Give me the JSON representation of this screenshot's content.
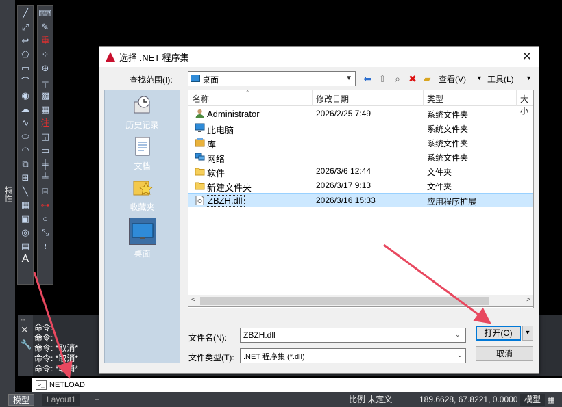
{
  "cad": {
    "side_tab_label": "特性",
    "history_lines": [
      "命令:",
      "命令:",
      "命令: *取消*",
      "命令: *取消*",
      "命令: *取消*"
    ],
    "command_input": "NETLOAD",
    "layout_tabs": [
      "模型",
      "Layout1",
      "+"
    ],
    "status": {
      "scale_label": "比例  未定义",
      "coordinates": "189.6628, 67.8221, 0.0000",
      "mode": "模型"
    },
    "toolbar_left_icons": [
      "line-icon",
      "construction-line-icon",
      "polyline-icon",
      "polygon-icon",
      "rectangle-icon",
      "arc-icon",
      "circle-icon",
      "revision-cloud-icon",
      "spline-icon",
      "ellipse-icon",
      "ellipse-arc-icon",
      "insert-block-icon",
      "make-block-icon",
      "point-icon",
      "hatch-icon",
      "gradient-icon",
      "region-icon",
      "table-icon",
      "text-icon"
    ],
    "toolbar_right_icons": [
      "code-icon",
      "paint-icon",
      "redraw-icon",
      "dots-icon",
      "zoom-icon",
      "dimension-icon",
      "qr-icon",
      "grid-icon",
      "annotation-icon",
      "rect-icon",
      "frame-icon",
      "bars-icon",
      "bars2-icon",
      "layer-icon",
      "red-mark-icon",
      "circle-icon",
      "scale-icon",
      "wave-icon"
    ]
  },
  "dialog": {
    "title": "选择 .NET 程序集",
    "look_in_label": "查找范围(I):",
    "look_in_value": "桌面",
    "view_menu": "查看(V)",
    "tools_menu": "工具(L)",
    "places": [
      {
        "label": "历史记录",
        "icon": "history-icon"
      },
      {
        "label": "文档",
        "icon": "documents-icon"
      },
      {
        "label": "收藏夹",
        "icon": "favorites-icon"
      },
      {
        "label": "桌面",
        "icon": "desktop-icon"
      }
    ],
    "columns": [
      "名称",
      "修改日期",
      "类型",
      "大小"
    ],
    "files": [
      {
        "name": "Administrator",
        "date": "2026/2/25 7:49",
        "type": "系统文件夹",
        "icon": "user-folder-icon"
      },
      {
        "name": "此电脑",
        "date": "",
        "type": "系统文件夹",
        "icon": "computer-icon"
      },
      {
        "name": "库",
        "date": "",
        "type": "系统文件夹",
        "icon": "library-icon"
      },
      {
        "name": "网络",
        "date": "",
        "type": "系统文件夹",
        "icon": "network-icon"
      },
      {
        "name": "软件",
        "date": "2026/3/6 12:44",
        "type": "文件夹",
        "icon": "folder-icon"
      },
      {
        "name": "新建文件夹",
        "date": "2026/3/17 9:13",
        "type": "文件夹",
        "icon": "folder-icon"
      },
      {
        "name": "ZBZH.dll",
        "date": "2026/3/16 15:33",
        "type": "应用程序扩展",
        "icon": "dll-file-icon"
      }
    ],
    "filename_label": "文件名(N):",
    "filename_value": "ZBZH.dll",
    "filetype_label": "文件类型(T):",
    "filetype_value": ".NET 程序集 (*.dll)",
    "open_button": "打开(O)",
    "cancel_button": "取消",
    "colors": {
      "accent": "#0078d7",
      "selection": "#cce8ff",
      "annotation_arrow": "#e8485f"
    }
  }
}
